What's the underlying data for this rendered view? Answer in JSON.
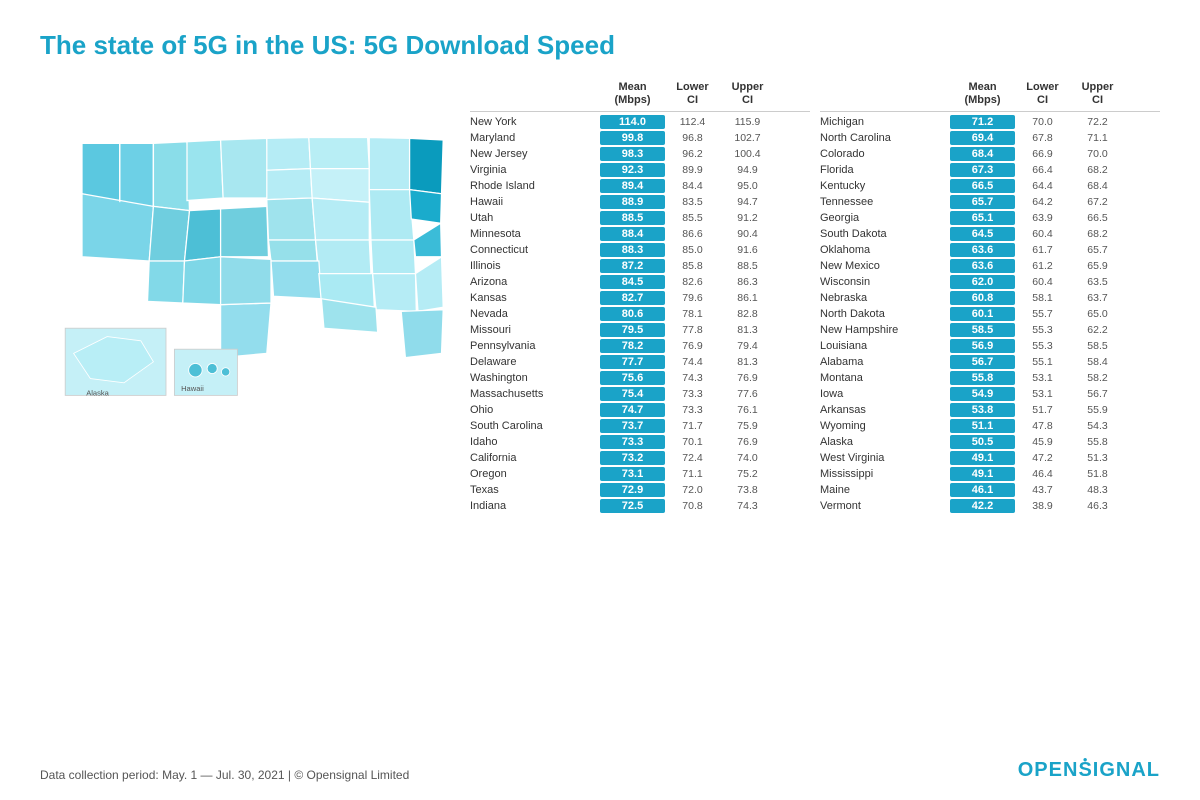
{
  "title": "The state of 5G in the US: 5G Download Speed",
  "footer": {
    "text": "Data collection period: May. 1 — Jul. 30, 2021 | © Opensignal Limited",
    "logo": "OPENSIGNAL"
  },
  "table1_header": {
    "state": "",
    "mean": "Mean\n(Mbps)",
    "lower": "Lower\nCI",
    "upper": "Upper\nCI"
  },
  "table1": [
    {
      "state": "New York",
      "mean": "114.0",
      "lower": "112.4",
      "upper": "115.9"
    },
    {
      "state": "Maryland",
      "mean": "99.8",
      "lower": "96.8",
      "upper": "102.7"
    },
    {
      "state": "New Jersey",
      "mean": "98.3",
      "lower": "96.2",
      "upper": "100.4"
    },
    {
      "state": "Virginia",
      "mean": "92.3",
      "lower": "89.9",
      "upper": "94.9"
    },
    {
      "state": "Rhode Island",
      "mean": "89.4",
      "lower": "84.4",
      "upper": "95.0"
    },
    {
      "state": "Hawaii",
      "mean": "88.9",
      "lower": "83.5",
      "upper": "94.7"
    },
    {
      "state": "Utah",
      "mean": "88.5",
      "lower": "85.5",
      "upper": "91.2"
    },
    {
      "state": "Minnesota",
      "mean": "88.4",
      "lower": "86.6",
      "upper": "90.4"
    },
    {
      "state": "Connecticut",
      "mean": "88.3",
      "lower": "85.0",
      "upper": "91.6"
    },
    {
      "state": "Illinois",
      "mean": "87.2",
      "lower": "85.8",
      "upper": "88.5"
    },
    {
      "state": "Arizona",
      "mean": "84.5",
      "lower": "82.6",
      "upper": "86.3"
    },
    {
      "state": "Kansas",
      "mean": "82.7",
      "lower": "79.6",
      "upper": "86.1"
    },
    {
      "state": "Nevada",
      "mean": "80.6",
      "lower": "78.1",
      "upper": "82.8"
    },
    {
      "state": "Missouri",
      "mean": "79.5",
      "lower": "77.8",
      "upper": "81.3"
    },
    {
      "state": "Pennsylvania",
      "mean": "78.2",
      "lower": "76.9",
      "upper": "79.4"
    },
    {
      "state": "Delaware",
      "mean": "77.7",
      "lower": "74.4",
      "upper": "81.3"
    },
    {
      "state": "Washington",
      "mean": "75.6",
      "lower": "74.3",
      "upper": "76.9"
    },
    {
      "state": "Massachusetts",
      "mean": "75.4",
      "lower": "73.3",
      "upper": "77.6"
    },
    {
      "state": "Ohio",
      "mean": "74.7",
      "lower": "73.3",
      "upper": "76.1"
    },
    {
      "state": "South Carolina",
      "mean": "73.7",
      "lower": "71.7",
      "upper": "75.9"
    },
    {
      "state": "Idaho",
      "mean": "73.3",
      "lower": "70.1",
      "upper": "76.9"
    },
    {
      "state": "California",
      "mean": "73.2",
      "lower": "72.4",
      "upper": "74.0"
    },
    {
      "state": "Oregon",
      "mean": "73.1",
      "lower": "71.1",
      "upper": "75.2"
    },
    {
      "state": "Texas",
      "mean": "72.9",
      "lower": "72.0",
      "upper": "73.8"
    },
    {
      "state": "Indiana",
      "mean": "72.5",
      "lower": "70.8",
      "upper": "74.3"
    }
  ],
  "table2": [
    {
      "state": "Michigan",
      "mean": "71.2",
      "lower": "70.0",
      "upper": "72.2"
    },
    {
      "state": "North Carolina",
      "mean": "69.4",
      "lower": "67.8",
      "upper": "71.1"
    },
    {
      "state": "Colorado",
      "mean": "68.4",
      "lower": "66.9",
      "upper": "70.0"
    },
    {
      "state": "Florida",
      "mean": "67.3",
      "lower": "66.4",
      "upper": "68.2"
    },
    {
      "state": "Kentucky",
      "mean": "66.5",
      "lower": "64.4",
      "upper": "68.4"
    },
    {
      "state": "Tennessee",
      "mean": "65.7",
      "lower": "64.2",
      "upper": "67.2"
    },
    {
      "state": "Georgia",
      "mean": "65.1",
      "lower": "63.9",
      "upper": "66.5"
    },
    {
      "state": "South Dakota",
      "mean": "64.5",
      "lower": "60.4",
      "upper": "68.2"
    },
    {
      "state": "Oklahoma",
      "mean": "63.6",
      "lower": "61.7",
      "upper": "65.7"
    },
    {
      "state": "New Mexico",
      "mean": "63.6",
      "lower": "61.2",
      "upper": "65.9"
    },
    {
      "state": "Wisconsin",
      "mean": "62.0",
      "lower": "60.4",
      "upper": "63.5"
    },
    {
      "state": "Nebraska",
      "mean": "60.8",
      "lower": "58.1",
      "upper": "63.7"
    },
    {
      "state": "North Dakota",
      "mean": "60.1",
      "lower": "55.7",
      "upper": "65.0"
    },
    {
      "state": "New Hampshire",
      "mean": "58.5",
      "lower": "55.3",
      "upper": "62.2"
    },
    {
      "state": "Louisiana",
      "mean": "56.9",
      "lower": "55.3",
      "upper": "58.5"
    },
    {
      "state": "Alabama",
      "mean": "56.7",
      "lower": "55.1",
      "upper": "58.4"
    },
    {
      "state": "Montana",
      "mean": "55.8",
      "lower": "53.1",
      "upper": "58.2"
    },
    {
      "state": "Iowa",
      "mean": "54.9",
      "lower": "53.1",
      "upper": "56.7"
    },
    {
      "state": "Arkansas",
      "mean": "53.8",
      "lower": "51.7",
      "upper": "55.9"
    },
    {
      "state": "Wyoming",
      "mean": "51.1",
      "lower": "47.8",
      "upper": "54.3"
    },
    {
      "state": "Alaska",
      "mean": "50.5",
      "lower": "45.9",
      "upper": "55.8"
    },
    {
      "state": "West Virginia",
      "mean": "49.1",
      "lower": "47.2",
      "upper": "51.3"
    },
    {
      "state": "Mississippi",
      "mean": "49.1",
      "lower": "46.4",
      "upper": "51.8"
    },
    {
      "state": "Maine",
      "mean": "46.1",
      "lower": "43.7",
      "upper": "48.3"
    },
    {
      "state": "Vermont",
      "mean": "42.2",
      "lower": "38.9",
      "upper": "46.3"
    }
  ]
}
